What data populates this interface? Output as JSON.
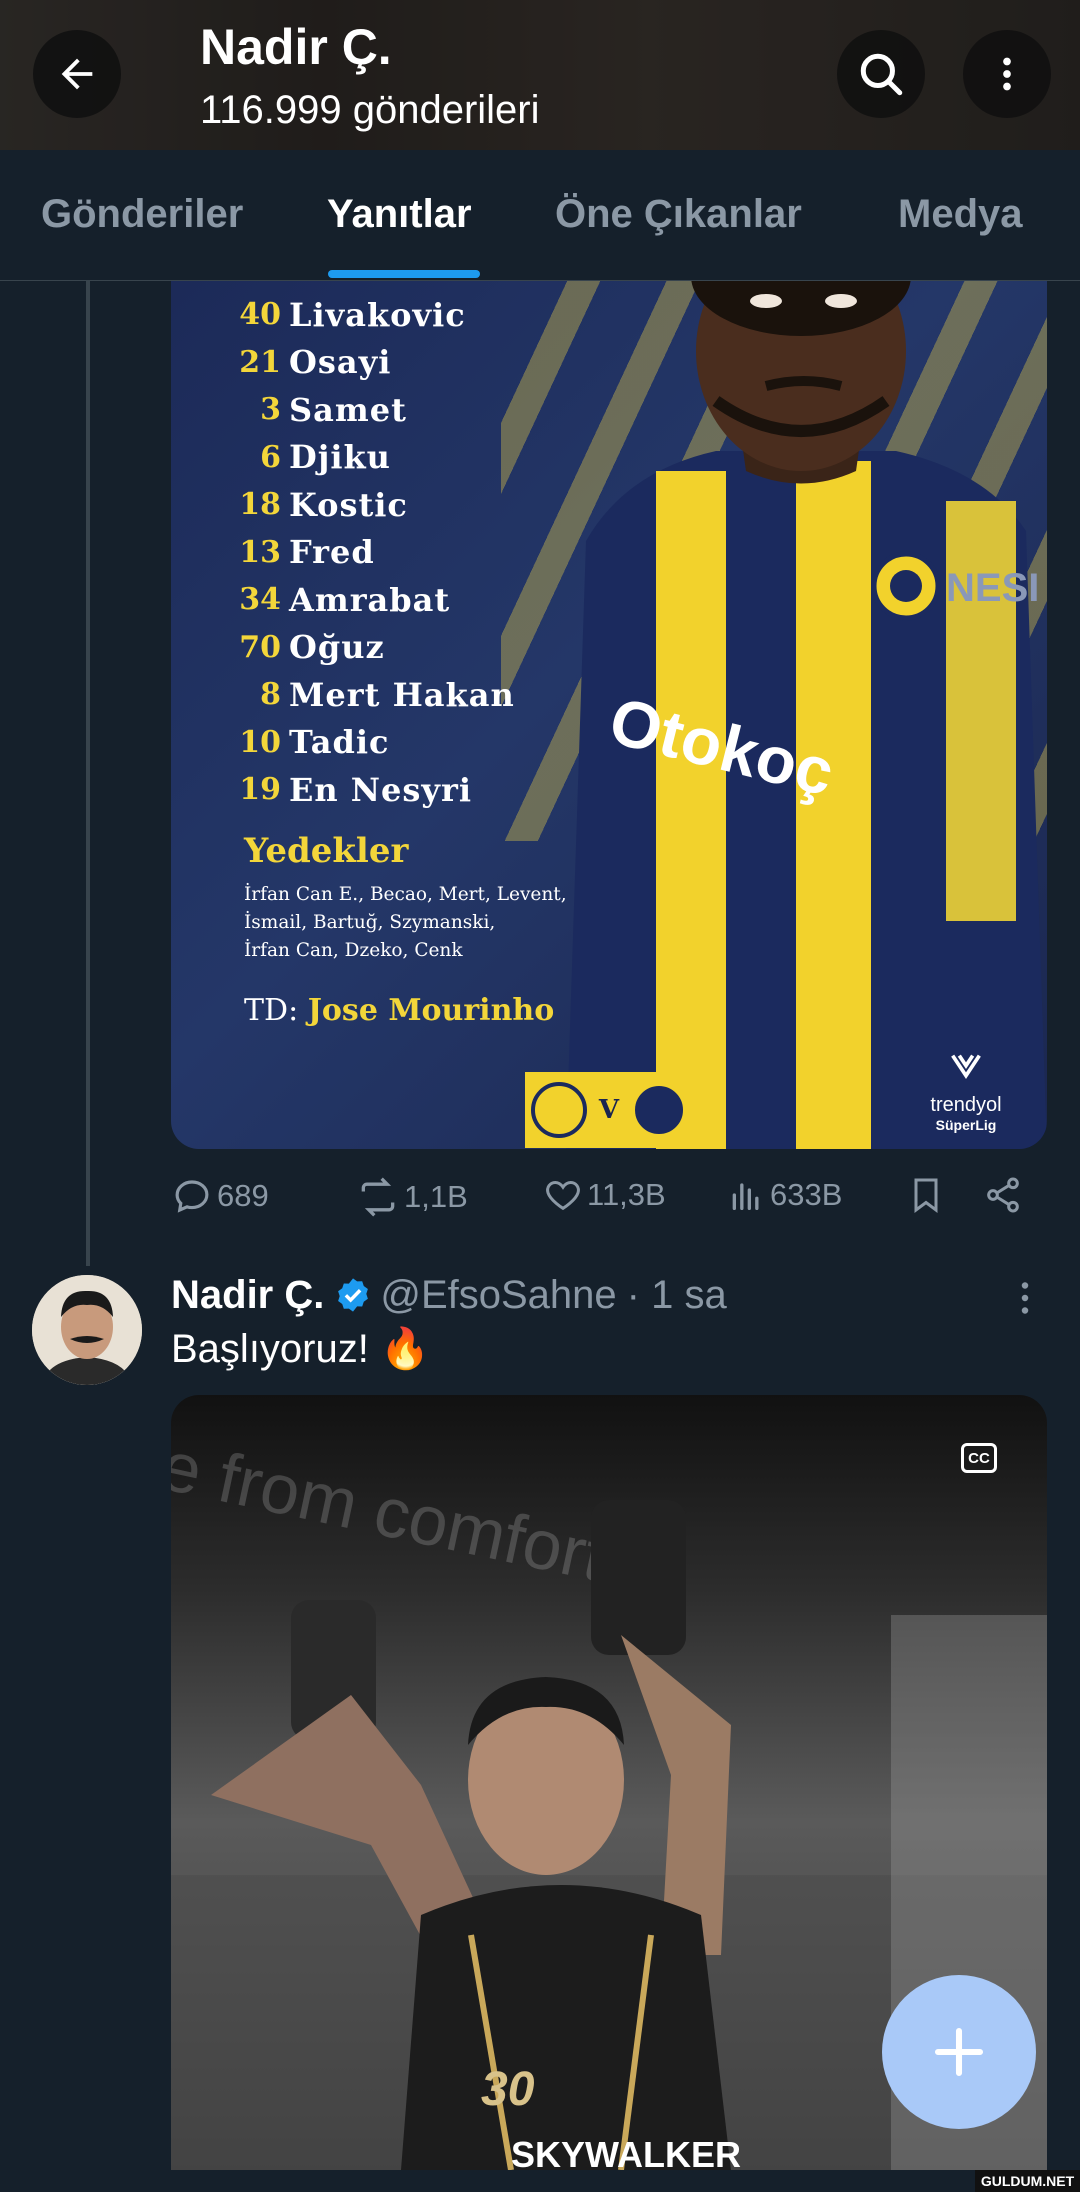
{
  "header": {
    "title": "Nadir Ç.",
    "subtitle": "116.999 gönderileri"
  },
  "tabs": [
    {
      "label": "Gönderiler",
      "active": false
    },
    {
      "label": "Yanıtlar",
      "active": true
    },
    {
      "label": "Öne Çıkanlar",
      "active": false
    },
    {
      "label": "Medya",
      "active": false
    }
  ],
  "lineup_image": {
    "players": [
      {
        "number": "40",
        "name": "Livakovic"
      },
      {
        "number": "21",
        "name": "Osayi"
      },
      {
        "number": "3",
        "name": "Samet"
      },
      {
        "number": "6",
        "name": "Djiku"
      },
      {
        "number": "18",
        "name": "Kostic"
      },
      {
        "number": "13",
        "name": "Fred"
      },
      {
        "number": "34",
        "name": "Amrabat"
      },
      {
        "number": "70",
        "name": "Oğuz"
      },
      {
        "number": "8",
        "name": "Mert Hakan"
      },
      {
        "number": "10",
        "name": "Tadic"
      },
      {
        "number": "19",
        "name": "En Nesyri"
      }
    ],
    "subs_title": "Yedekler",
    "subs_lines": [
      "İrfan Can E., Becao, Mert, Levent,",
      "İsmail, Bartuğ, Szymanski,",
      "İrfan Can, Dzeko, Cenk"
    ],
    "coach_label": "TD:",
    "coach_name": "Jose Mourinho",
    "league_line1": "trendyol",
    "league_line2": "SüperLig",
    "match_vs": "V",
    "sponsor": "Otokoç",
    "colors": {
      "yellow": "#f3d63a",
      "navy": "#1c2a58"
    }
  },
  "post1_actions": {
    "replies": "689",
    "reposts": "1,1B",
    "likes": "11,3B",
    "views": "633B"
  },
  "post2": {
    "name": "Nadir Ç.",
    "handle": "@EfsoSahne",
    "time": "· 1 sa",
    "text": "Başlıyoruz! 🔥",
    "video_wall_text": "e from comfort",
    "video_jersey_text": "SKYWALKER",
    "video_jersey_number": "30",
    "cc_label": "CC"
  },
  "watermark": "GULDUM.NET",
  "accent_color": "#1d9bf0"
}
